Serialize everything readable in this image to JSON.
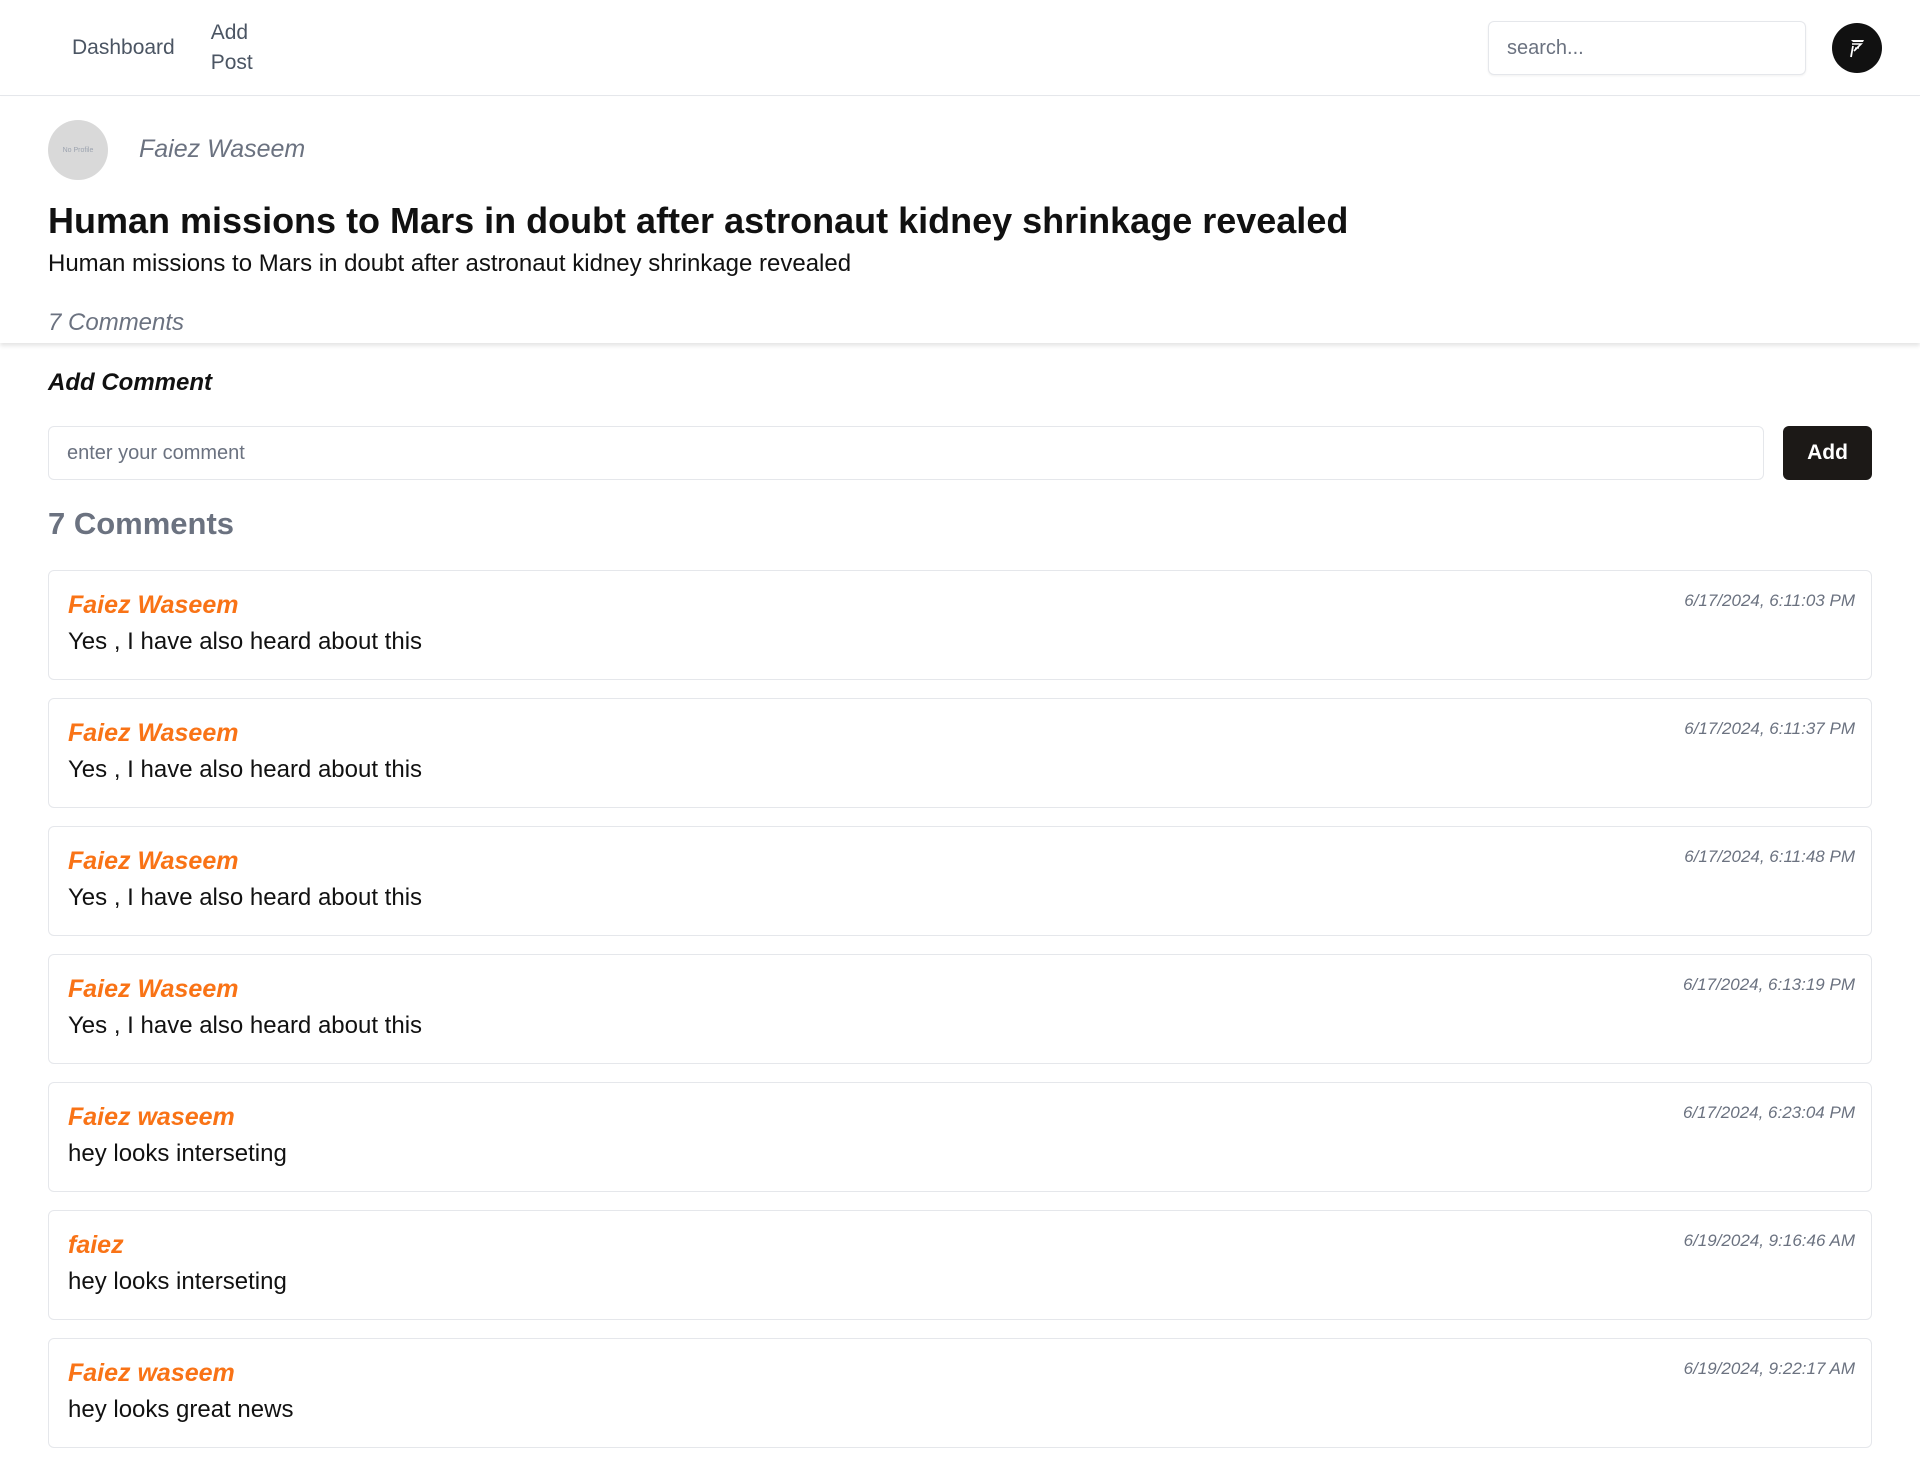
{
  "nav": {
    "dashboard": "Dashboard",
    "add_post_line1": "Add",
    "add_post_line2": "Post",
    "search_placeholder": "search...",
    "logo_icon": "brand-logo-icon"
  },
  "post": {
    "avatar_text": "No Profile",
    "author": "Faiez Waseem",
    "title": "Human missions to Mars in doubt after astronaut kidney shrinkage revealed",
    "description": "Human missions to Mars in doubt after astronaut kidney shrinkage revealed",
    "comments_count_label": "7 Comments"
  },
  "add_comment": {
    "label": "Add Comment",
    "placeholder": "enter your comment",
    "button": "Add"
  },
  "comments_heading": "7 Comments",
  "comments": [
    {
      "author": "Faiez Waseem",
      "time": "6/17/2024, 6:11:03 PM",
      "text": "Yes , I have also heard about this"
    },
    {
      "author": "Faiez Waseem",
      "time": "6/17/2024, 6:11:37 PM",
      "text": "Yes , I have also heard about this"
    },
    {
      "author": "Faiez Waseem",
      "time": "6/17/2024, 6:11:48 PM",
      "text": "Yes , I have also heard about this"
    },
    {
      "author": "Faiez Waseem",
      "time": "6/17/2024, 6:13:19 PM",
      "text": "Yes , I have also heard about this"
    },
    {
      "author": "Faiez waseem",
      "time": "6/17/2024, 6:23:04 PM",
      "text": "hey looks interseting"
    },
    {
      "author": "faiez",
      "time": "6/19/2024, 9:16:46 AM",
      "text": "hey looks interseting"
    },
    {
      "author": "Faiez waseem",
      "time": "6/19/2024, 9:22:17 AM",
      "text": "hey looks great news"
    }
  ],
  "colors": {
    "accent": "#f97316",
    "button_bg": "#1c1917",
    "muted_text": "#6b7280"
  }
}
